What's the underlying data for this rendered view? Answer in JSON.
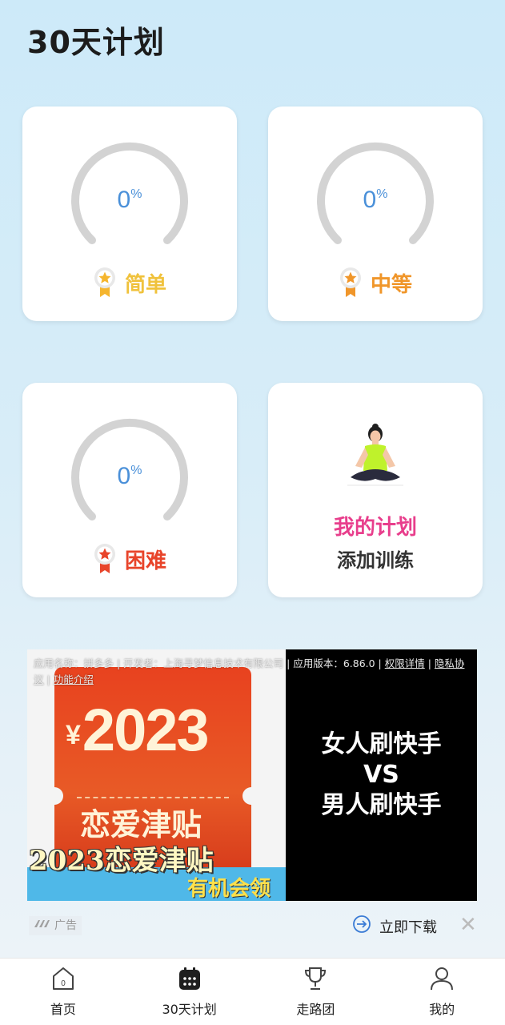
{
  "header": {
    "title": "30天计划"
  },
  "levels": [
    {
      "label": "简单",
      "percent_num": "0",
      "percent_sign": "%",
      "progress": 0,
      "color": "#f0c23c",
      "medal_color": "#f5b52e"
    },
    {
      "label": "中等",
      "percent_num": "0",
      "percent_sign": "%",
      "progress": 0,
      "color": "#f0962a",
      "medal_color": "#f0962a"
    },
    {
      "label": "困难",
      "percent_num": "0",
      "percent_sign": "%",
      "progress": 0,
      "color": "#e8442a",
      "medal_color": "#e8442a"
    }
  ],
  "my_plan": {
    "title": "我的计划",
    "subtitle": "添加训练"
  },
  "ad": {
    "info_prefix": "应用名称：拼多多 | 开发者：上海寻梦信息技术有限公司 | 应用版本：6.86.0 | ",
    "permissions": "权限详情",
    "sep1": " | ",
    "privacy": "隐私协议",
    "sep2": " | ",
    "features": "功能介绍",
    "yen": "¥",
    "year": "2023",
    "love_subsidy": "恋爱津贴",
    "banner": "2023恋爱津贴",
    "opportunity": "有机会领",
    "right_line1": "女人刷快手",
    "right_line2": "VS",
    "right_line3": "男人刷快手",
    "tag": "广告",
    "download": "立即下载",
    "close": "✕"
  },
  "tabs": [
    {
      "label": "首页",
      "icon": "home-icon"
    },
    {
      "label": "30天计划",
      "icon": "calendar-icon"
    },
    {
      "label": "走路团",
      "icon": "trophy-icon"
    },
    {
      "label": "我的",
      "icon": "profile-icon"
    }
  ],
  "colors": {
    "gauge_track": "#d3d3d3",
    "percent": "#4a90d9",
    "plan_title": "#e83e8c"
  }
}
